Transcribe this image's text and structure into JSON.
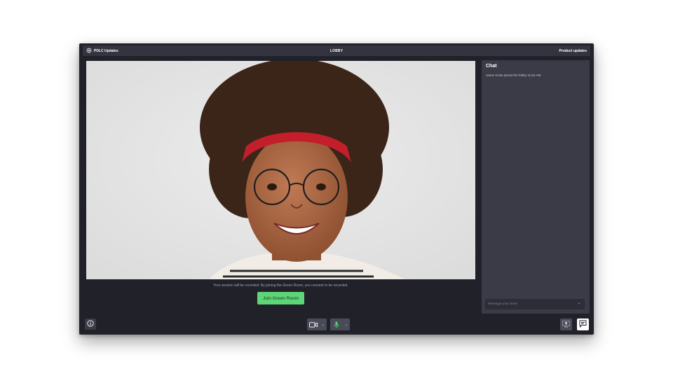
{
  "header": {
    "brand_label": "PDLC Updates",
    "center_label": "LOBBY",
    "right_label": "Product updates"
  },
  "video": {
    "consent_text": "Your session will be recorded. By joining the Green Room, you consent to be recorded.",
    "join_label": "Join Green Room"
  },
  "chat": {
    "title": "Chat",
    "messages": [
      {
        "text": "Jason Krute joined the lobby 11:52 AM"
      }
    ],
    "input_placeholder": "Message your team"
  },
  "toolbar": {
    "info_icon": "info-icon",
    "camera_icon": "camera-icon",
    "mic_icon": "microphone-icon",
    "share_icon": "screen-share-icon",
    "chat_icon": "chat-icon"
  },
  "colors": {
    "accent_green": "#5ed577",
    "window_bg": "#202129",
    "panel_bg": "#3a3b47",
    "mic_green": "#5ed577"
  }
}
